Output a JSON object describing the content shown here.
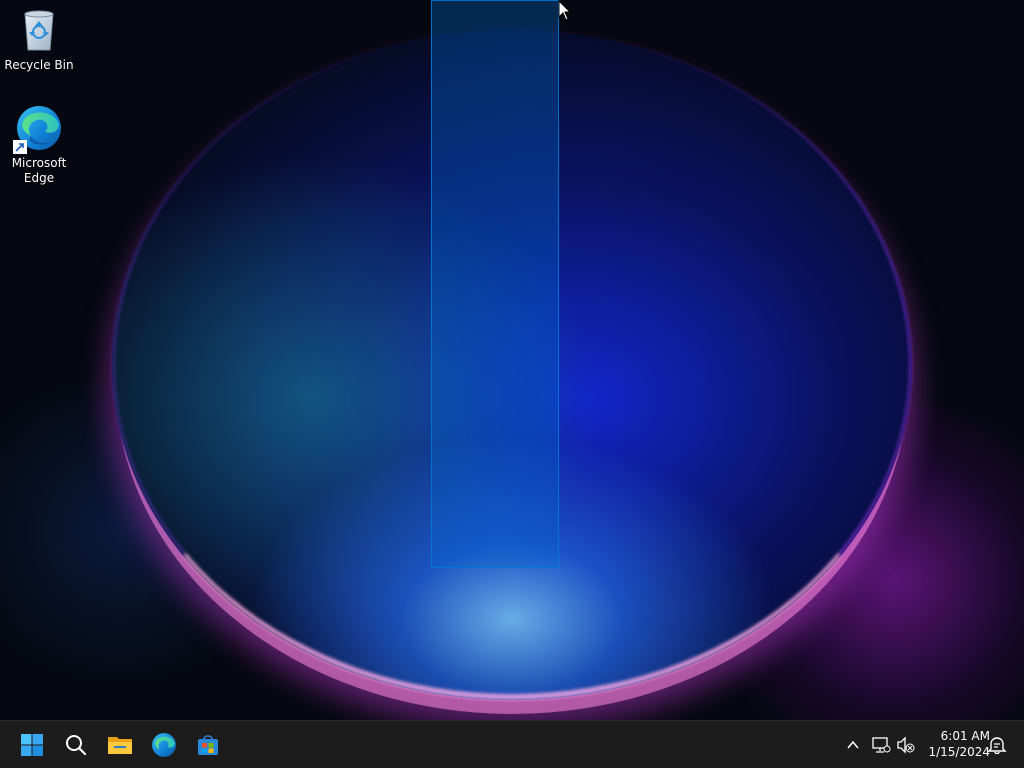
{
  "desktop": {
    "icons": [
      {
        "label": "Recycle Bin",
        "icon": "recycle-bin-icon"
      },
      {
        "label": "Microsoft Edge",
        "icon": "edge-icon"
      }
    ]
  },
  "taskbar": {
    "pinned": [
      {
        "name": "Start",
        "icon": "windows-start-icon"
      },
      {
        "name": "Search",
        "icon": "search-icon"
      },
      {
        "name": "File Explorer",
        "icon": "folder-icon"
      },
      {
        "name": "Microsoft Edge",
        "icon": "edge-icon"
      },
      {
        "name": "Microsoft Store",
        "icon": "store-icon"
      }
    ],
    "tray": {
      "icons": [
        "chevron-up-icon",
        "network-icon",
        "volume-muted-icon",
        "notification-icon"
      ]
    },
    "clock": {
      "time": "6:01 AM",
      "date": "1/15/2024"
    }
  },
  "colors": {
    "taskbar": "#1c1c1c",
    "selection": "#0066cc",
    "accent": "#0078d4"
  }
}
